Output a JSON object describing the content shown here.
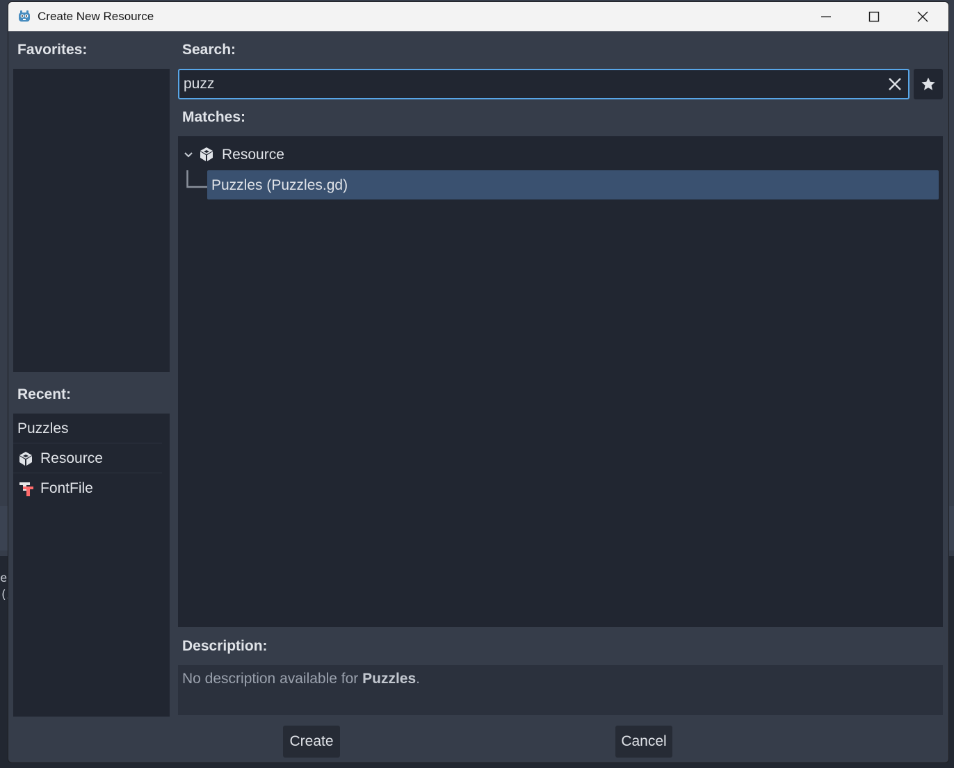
{
  "window": {
    "title": "Create New Resource",
    "minimize_icon": "minimize-icon",
    "maximize_icon": "maximize-icon",
    "close_icon": "close-icon"
  },
  "favorites": {
    "label": "Favorites:"
  },
  "recent": {
    "label": "Recent:",
    "items": [
      {
        "label": "Puzzles",
        "icon": ""
      },
      {
        "label": "Resource",
        "icon": "resource-cube-icon"
      },
      {
        "label": "FontFile",
        "icon": "font-file-icon"
      }
    ]
  },
  "search": {
    "label": "Search:",
    "value": "puzz",
    "placeholder": ""
  },
  "matches": {
    "label": "Matches:",
    "tree": {
      "root": {
        "label": "Resource",
        "icon": "resource-cube-icon",
        "expanded": true
      },
      "children": [
        {
          "label": "Puzzles (Puzzles.gd)",
          "selected": true
        }
      ]
    }
  },
  "description": {
    "label": "Description:",
    "prefix": "No description available for ",
    "name": "Puzzles",
    "suffix": "."
  },
  "buttons": {
    "create": "Create",
    "cancel": "Cancel"
  },
  "background": {
    "text_line1": "eg",
    "text_line2": "(A"
  },
  "colors": {
    "accent": "#58a6e8",
    "selection": "#3a5170",
    "panel": "#212631",
    "dialog_bg": "#363d4a"
  }
}
